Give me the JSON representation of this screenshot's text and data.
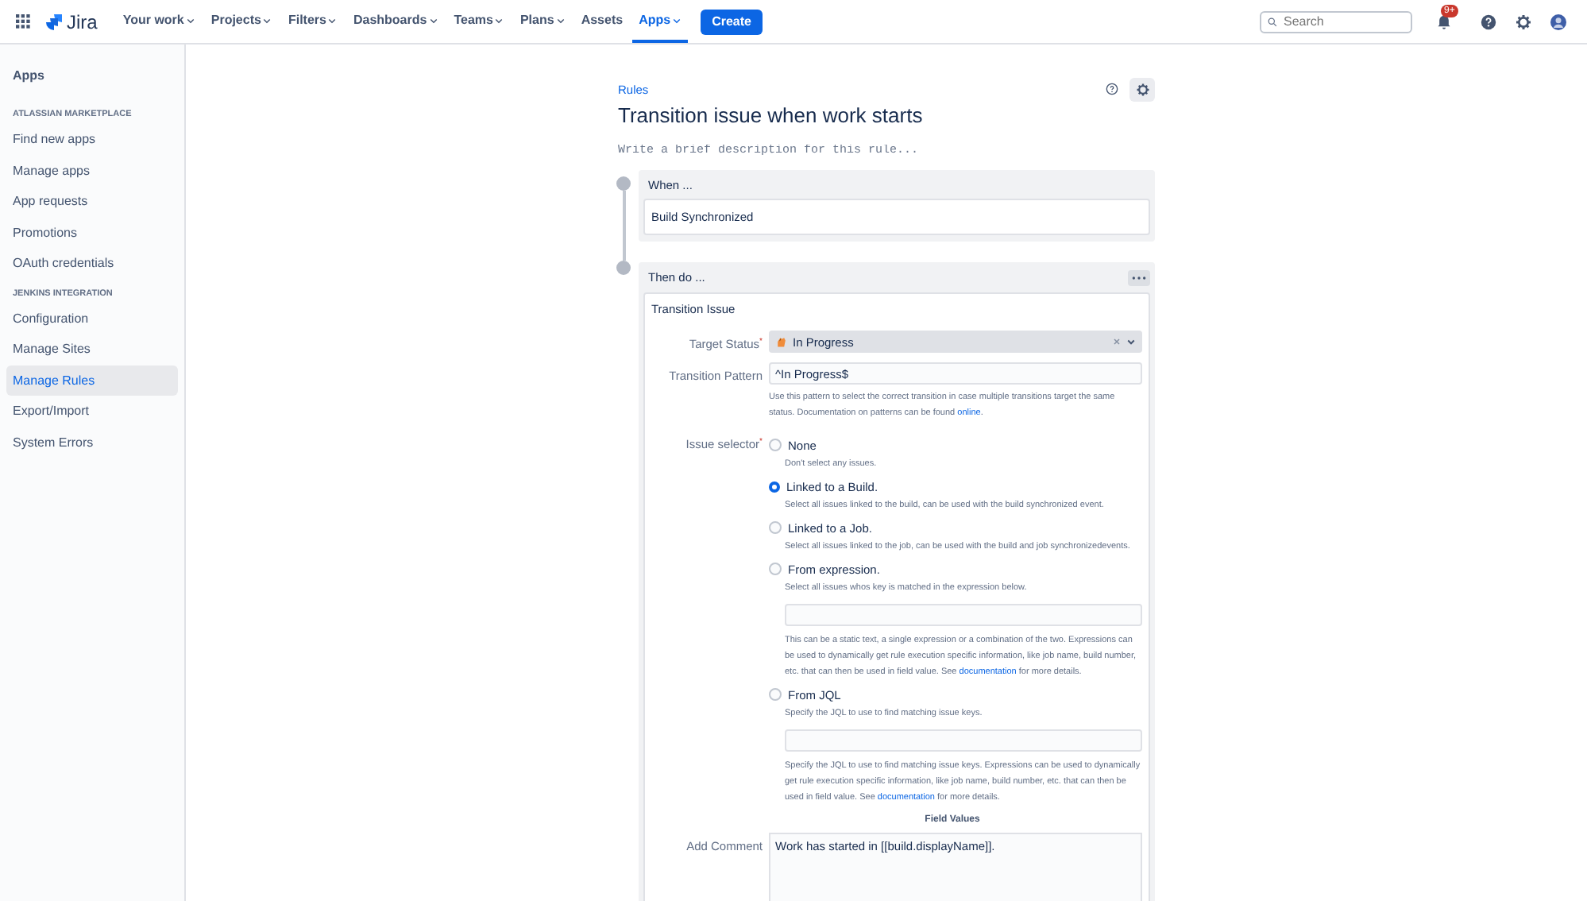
{
  "nav": {
    "product": "Jira",
    "items": [
      {
        "label": "Your work",
        "has_menu": true,
        "selected": false
      },
      {
        "label": "Projects",
        "has_menu": true,
        "selected": false
      },
      {
        "label": "Filters",
        "has_menu": true,
        "selected": false
      },
      {
        "label": "Dashboards",
        "has_menu": true,
        "selected": false
      },
      {
        "label": "Teams",
        "has_menu": true,
        "selected": false
      },
      {
        "label": "Plans",
        "has_menu": true,
        "selected": false
      },
      {
        "label": "Assets",
        "has_menu": false,
        "selected": false
      },
      {
        "label": "Apps",
        "has_menu": true,
        "selected": true
      }
    ],
    "create": "Create",
    "search": {
      "placeholder": "Search"
    },
    "notification_badge": "9+"
  },
  "sidebar": {
    "title": "Apps",
    "sections": [
      {
        "heading": "ATLASSIAN MARKETPLACE",
        "items": [
          {
            "label": "Find new apps",
            "selected": false
          },
          {
            "label": "Manage apps",
            "selected": false
          },
          {
            "label": "App requests",
            "selected": false
          },
          {
            "label": "Promotions",
            "selected": false
          },
          {
            "label": "OAuth credentials",
            "selected": false
          }
        ]
      },
      {
        "heading": "JENKINS INTEGRATION",
        "items": [
          {
            "label": "Configuration",
            "selected": false
          },
          {
            "label": "Manage Sites",
            "selected": false
          },
          {
            "label": "Manage Rules",
            "selected": true
          },
          {
            "label": "Export/Import",
            "selected": false
          },
          {
            "label": "System Errors",
            "selected": false
          }
        ]
      }
    ]
  },
  "rule": {
    "breadcrumb": "Rules",
    "title": "Transition issue when work starts",
    "description_placeholder": "Write a brief description for this rule...",
    "trigger": {
      "heading": "When ...",
      "value": "Build Synchronized"
    },
    "action": {
      "heading": "Then do ...",
      "title": "Transition Issue",
      "target_status": {
        "label": "Target Status",
        "required_mark": "*",
        "value": "In Progress"
      },
      "transition_pattern": {
        "label": "Transition Pattern",
        "value": "^In Progress$",
        "help": {
          "before": "Use this pattern to select the correct transition in case multiple transitions target the same status. Documentation on patterns can be found ",
          "link": "online",
          "after": "."
        }
      },
      "issue_selector": {
        "label": "Issue selector",
        "required_mark": "*",
        "options": [
          {
            "kind": "plain",
            "label": "None",
            "description": "Don't select any issues.",
            "selected": false
          },
          {
            "kind": "plain",
            "label": "Linked to a Build.",
            "description": "Select all issues linked to the build, can be used with the build synchronized event.",
            "selected": true
          },
          {
            "kind": "plain",
            "label": "Linked to a Job.",
            "description": "Select all issues linked to the job, can be used with the build and job synchronizedevents.",
            "selected": false
          },
          {
            "kind": "with-input",
            "label": "From expression.",
            "description": "Select all issues whos key is matched in the expression below.",
            "selected": false,
            "help": {
              "before": "This can be a static text, a single expression or a combination of the two. Expressions can be used to dynamically get rule execution specific information, like job name, build number, etc. that can then be used in field value. See ",
              "link": "documentation",
              "after": " for more details."
            }
          },
          {
            "kind": "with-input",
            "label": "From JQL",
            "description": "Specify the JQL to use to find matching issue keys.",
            "selected": false,
            "help": {
              "before": "Specify the JQL to use to find matching issue keys. Expressions can be used to dynamically get rule execution specific information, like job name, build number, etc. that can then be used in field value. See ",
              "link": "documentation",
              "after": " for more details."
            }
          }
        ]
      },
      "field_values_heading": "Field Values",
      "add_comment": {
        "label": "Add Comment",
        "value": "Work has started in [[build.displayName]]."
      }
    }
  }
}
